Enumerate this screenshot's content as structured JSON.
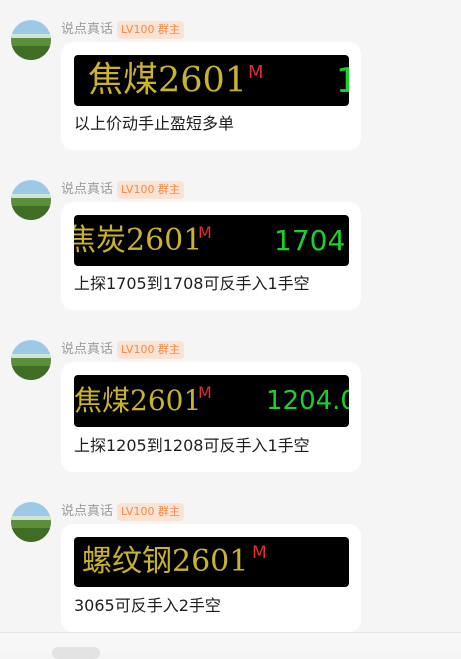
{
  "messages": [
    {
      "sender": "说点真话",
      "badge": "LV100 群主",
      "ticker": {
        "name": "焦煤2601",
        "flag": "M",
        "price": "1"
      },
      "text": "以上价动手止盈短多单"
    },
    {
      "sender": "说点真话",
      "badge": "LV100 群主",
      "ticker": {
        "name": "焦炭2601",
        "flag": "M",
        "price": "1704"
      },
      "text": "上探1705到1708可反手入1手空"
    },
    {
      "sender": "说点真话",
      "badge": "LV100 群主",
      "ticker": {
        "name": "焦煤2601",
        "flag": "M",
        "price": "1204.0"
      },
      "text": "上探1205到1208可反手入1手空"
    },
    {
      "sender": "说点真话",
      "badge": "LV100 群主",
      "ticker": {
        "name": "螺纹钢2601",
        "flag": "M",
        "price": ""
      },
      "text": "3065可反手入2手空"
    }
  ]
}
